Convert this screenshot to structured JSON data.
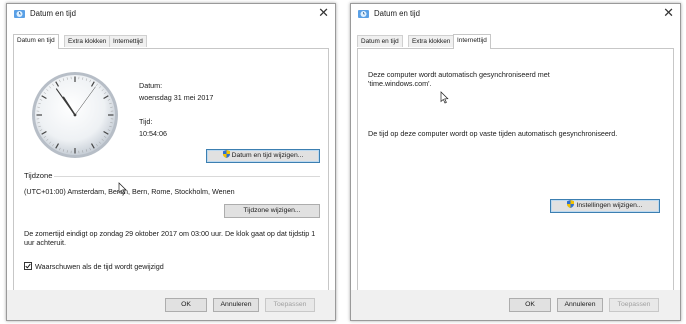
{
  "left_dialog": {
    "title": "Datum en tijd",
    "tabs": [
      {
        "label": "Datum en tijd",
        "active": true
      },
      {
        "label": "Extra klokken",
        "active": false
      },
      {
        "label": "Internettijd",
        "active": false
      }
    ],
    "clock": {
      "hour": 10,
      "minute": 54,
      "second": 6
    },
    "date_label": "Datum:",
    "date_value": "woensdag 31 mei 2017",
    "time_label": "Tijd:",
    "time_value": "10:54:06",
    "change_datetime_button": "Datum en tijd wijzigen...",
    "timezone_heading": "Tijdzone",
    "timezone_value": "(UTC+01:00) Amsterdam, Berlijn, Bern, Rome, Stockholm, Wenen",
    "change_timezone_button": "Tijdzone wijzigen...",
    "dst_notice": "De zomertijd eindigt op zondag 29 oktober 2017 om 03:00 uur. De klok gaat op dat tijdstip 1 uur achteruit.",
    "notify_checkbox_label": "Waarschuwen als de tijd wordt gewijzigd",
    "notify_checked": true,
    "ok_button": "OK",
    "cancel_button": "Annuleren",
    "apply_button": "Toepassen"
  },
  "right_dialog": {
    "title": "Datum en tijd",
    "tabs": [
      {
        "label": "Datum en tijd",
        "active": false
      },
      {
        "label": "Extra klokken",
        "active": false
      },
      {
        "label": "Internettijd",
        "active": true
      }
    ],
    "sync_text": "Deze computer wordt automatisch gesynchroniseerd met 'time.windows.com'.",
    "schedule_text": "De tijd op deze computer wordt op vaste tijden automatisch gesynchroniseerd.",
    "change_settings_button": "Instellingen wijzigen...",
    "ok_button": "OK",
    "cancel_button": "Annuleren",
    "apply_button": "Toepassen"
  },
  "colors": {
    "focus_border": "#3c7fb1",
    "shield_blue": "#2f6fd0",
    "shield_yellow": "#f2c200"
  }
}
